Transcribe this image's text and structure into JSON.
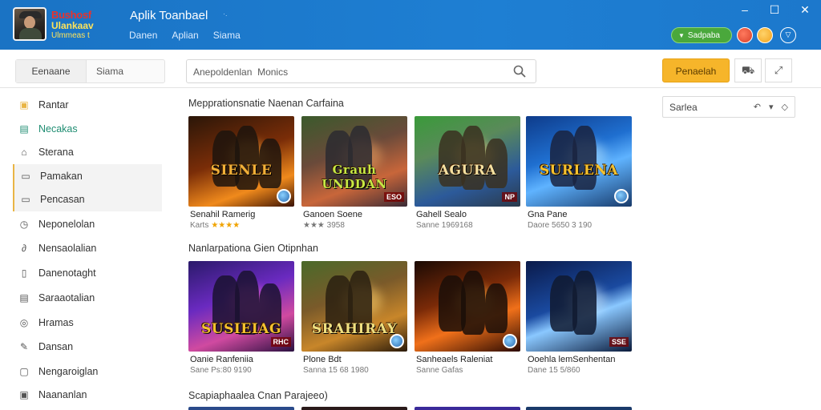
{
  "app": {
    "brand_line1": "Bushosf",
    "brand_line2": "Ulankaav",
    "brand_line3": "Ulmmeas t",
    "title": "Aplik Toanbael",
    "title_mark": "·.",
    "nav": [
      "Danen",
      "Aplian",
      "Siama"
    ],
    "status_pill": "Sadpaba",
    "window_controls": [
      "–",
      "☐",
      "✕"
    ]
  },
  "toolbar": {
    "tab_active": "Eenaane",
    "tab_inactive": "Siama",
    "search_placeholder": "Anepoldenlan  Monics",
    "primary_button": "Penaelah",
    "tool_icons": [
      "cart-icon",
      "expand-icon"
    ]
  },
  "sidebar": {
    "items": [
      {
        "label": "Rantar",
        "icon": "home-icon",
        "glyph": "▣",
        "color": "#e9b545",
        "selected": false,
        "green": false
      },
      {
        "label": "Necakas",
        "icon": "tag-icon",
        "glyph": "▤",
        "color": "#1f8d72",
        "selected": false,
        "green": true
      },
      {
        "label": "Sterana",
        "icon": "store-icon",
        "glyph": "⌂",
        "color": "#555",
        "selected": false,
        "green": false
      },
      {
        "label": "Pamakan",
        "icon": "document-icon",
        "glyph": "▭",
        "color": "#555",
        "selected": true,
        "green": false
      },
      {
        "label": "Pencasan",
        "icon": "folder-icon",
        "glyph": "▭",
        "color": "#555",
        "selected": true,
        "green": false
      },
      {
        "label": "Neponelolan",
        "icon": "clock-icon",
        "glyph": "◷",
        "color": "#555",
        "selected": false,
        "green": false
      },
      {
        "label": "Nensaolalian",
        "icon": "link-icon",
        "glyph": "∂",
        "color": "#555",
        "selected": false,
        "green": false
      },
      {
        "label": "Danenotaght",
        "icon": "book-icon",
        "glyph": "▯",
        "color": "#555",
        "selected": false,
        "green": false
      },
      {
        "label": "Saraaotalian",
        "icon": "list-icon",
        "glyph": "▤",
        "color": "#555",
        "selected": false,
        "green": false
      },
      {
        "label": "Hramas",
        "icon": "bulb-icon",
        "glyph": "◎",
        "color": "#555",
        "selected": false,
        "green": false
      },
      {
        "label": "Dansan",
        "icon": "pen-icon",
        "glyph": "✎",
        "color": "#555",
        "selected": false,
        "green": false
      },
      {
        "label": "Nengaroiglan",
        "icon": "box-icon",
        "glyph": "▢",
        "color": "#555",
        "selected": false,
        "green": false
      },
      {
        "label": "Naananlan",
        "icon": "grid-icon",
        "glyph": "▣",
        "color": "#555",
        "selected": false,
        "green": false
      }
    ]
  },
  "filter": {
    "label": "Sarlea",
    "icons": [
      "↶",
      "▾",
      "◇"
    ]
  },
  "sections": [
    {
      "title": "Mepprationsnatie Naenan Carfaina",
      "cards": [
        {
          "name": "Senahil Ramerig",
          "meta": "Karts",
          "stars": "★★★★ ",
          "art_text": "SIENLE",
          "badge": "round"
        },
        {
          "name": "Ganoen Soene",
          "meta": "★★★ 3958",
          "stars": "",
          "art_text": "Grauh UNDDAN",
          "badge": "ESO"
        },
        {
          "name": "Gahell Sealo",
          "meta": "Sanne 1969168",
          "stars": "",
          "art_text": "AGURA",
          "badge": "NP"
        },
        {
          "name": "Gna Pane",
          "meta": "Daore 5650 3 190",
          "stars": "",
          "art_text": "SURLENA",
          "badge": "round"
        }
      ]
    },
    {
      "title": "Nanlarpationa Gien Otipnhan",
      "cards": [
        {
          "name": "Oanie Ranfeniia",
          "meta": "Sane Ps:80 9190",
          "stars": "",
          "art_text": "SUSIEIAG",
          "badge": "RHC"
        },
        {
          "name": "Plone Bdt",
          "meta": "Sanna 15 68 1980",
          "stars": "",
          "art_text": "SRAHIRAY",
          "badge": "round"
        },
        {
          "name": "Sanheaels Raleniat",
          "meta": "Sanne Gafas",
          "stars": "",
          "art_text": "",
          "badge": "round"
        },
        {
          "name": "Ooehla lemSenhentan",
          "meta": "Dane 15 5/860",
          "stars": "",
          "art_text": "",
          "badge": "SSE"
        }
      ]
    },
    {
      "title": "Scapiaphaalea Cnan Parajeeo)",
      "cards": []
    }
  ]
}
